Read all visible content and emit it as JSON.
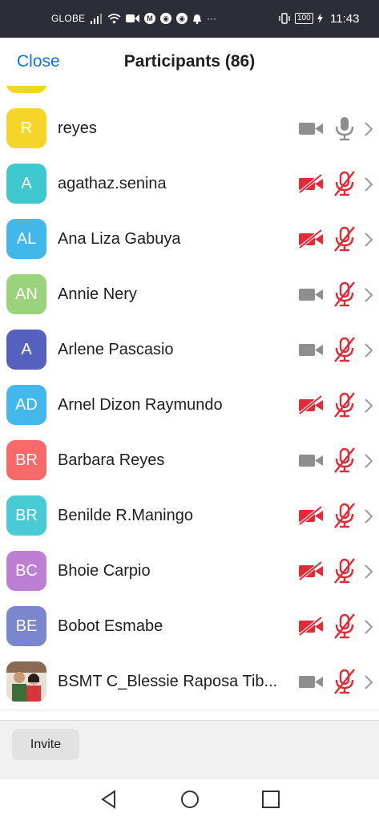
{
  "status_bar": {
    "carrier": "GLOBE",
    "time": "11:43",
    "battery": "100",
    "app_icon": "M",
    "more": "···"
  },
  "header": {
    "close_label": "Close",
    "title": "Participants (86)"
  },
  "participants": [
    {
      "name": "reyes",
      "initials": "R",
      "color": "#f6d52a",
      "video_on": true,
      "muted": false
    },
    {
      "name": "agathaz.senina",
      "initials": "A",
      "color": "#3fc9cf",
      "video_on": false,
      "muted": true
    },
    {
      "name": "Ana Liza Gabuya",
      "initials": "AL",
      "color": "#42b7ea",
      "video_on": false,
      "muted": true
    },
    {
      "name": "Annie Nery",
      "initials": "AN",
      "color": "#9bd27c",
      "video_on": true,
      "muted": true
    },
    {
      "name": "Arlene Pascasio",
      "initials": "A",
      "color": "#5661bf",
      "video_on": true,
      "muted": true
    },
    {
      "name": "Arnel Dizon Raymundo",
      "initials": "AD",
      "color": "#43b8ec",
      "video_on": false,
      "muted": true
    },
    {
      "name": "Barbara Reyes",
      "initials": "BR",
      "color": "#f86a6a",
      "video_on": true,
      "muted": true
    },
    {
      "name": "Benilde R.Maningo",
      "initials": "BR",
      "color": "#49cbd6",
      "video_on": false,
      "muted": true
    },
    {
      "name": "Bhoie Carpio",
      "initials": "BC",
      "color": "#bc7fd3",
      "video_on": false,
      "muted": true
    },
    {
      "name": "Bobot Esmabe",
      "initials": "BE",
      "color": "#7a87cf",
      "video_on": false,
      "muted": true
    },
    {
      "name": "BSMT C_Blessie Raposa Tib...",
      "initials": "",
      "color": "#c98b6b",
      "video_on": true,
      "muted": true,
      "photo": true
    }
  ],
  "colors": {
    "accent": "#0e72ed",
    "muted_red": "#e32a36",
    "icon_grey": "#8e8e8e"
  },
  "footer": {
    "invite_label": "Invite"
  },
  "nav": {
    "back": "back-icon",
    "home": "home-icon",
    "recents": "recents-icon"
  }
}
